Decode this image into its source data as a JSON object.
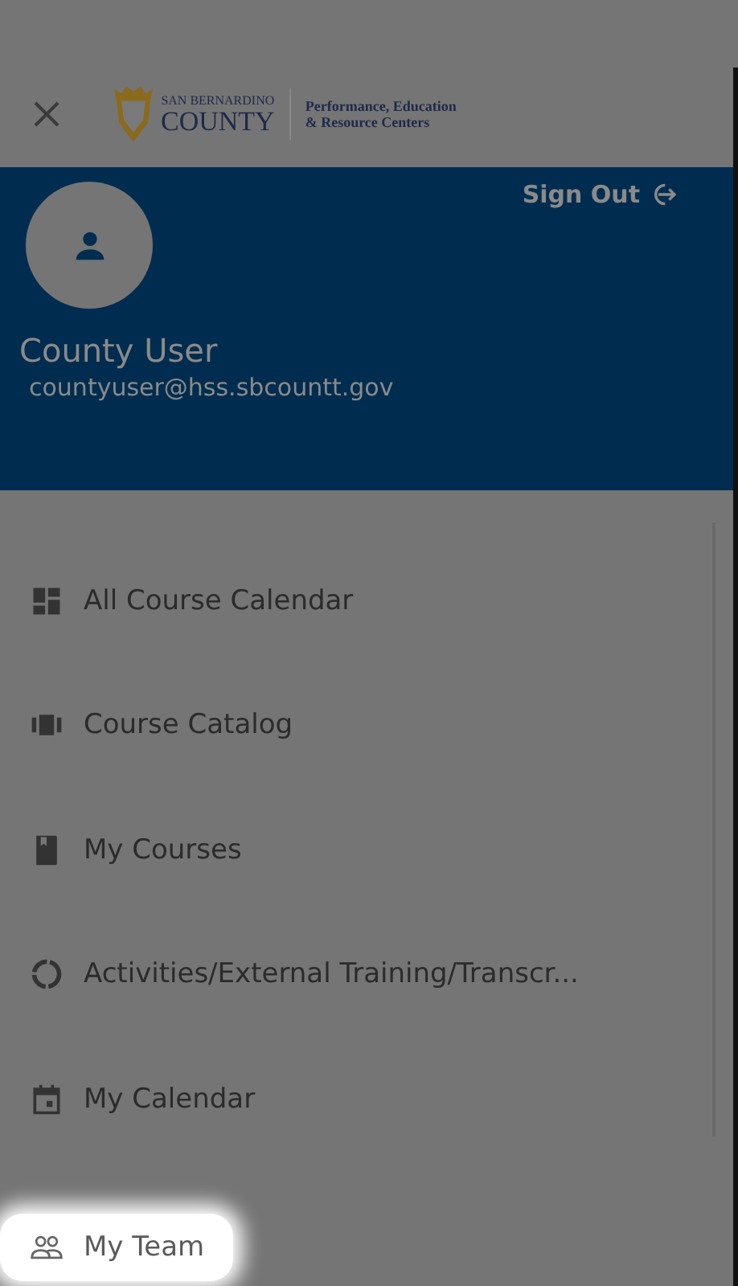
{
  "logo": {
    "line_1": "SAN BERNARDINO",
    "line_2": "COUNTY",
    "tagline_1": "Performance, Education",
    "tagline_2": "& Resource Centers"
  },
  "user": {
    "name": "County User",
    "email": "countyuser@hss.sbcountt.gov",
    "sign_out": "Sign Out"
  },
  "menu": [
    {
      "label": "All Course Calendar",
      "highlighted": false
    },
    {
      "label": "Course Catalog",
      "highlighted": false
    },
    {
      "label": "My Courses",
      "highlighted": false
    },
    {
      "label": "Activities/External Training/Transcr...",
      "highlighted": false
    },
    {
      "label": "My Calendar",
      "highlighted": false
    },
    {
      "label": "My Team",
      "highlighted": true
    }
  ]
}
